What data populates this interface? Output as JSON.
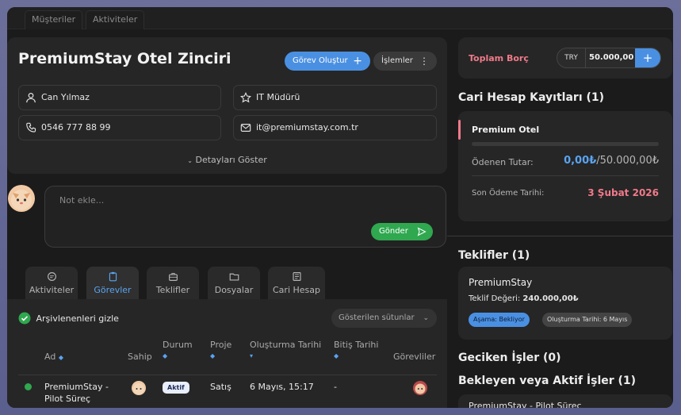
{
  "top_tabs": [
    "Müşteriler",
    "Aktiviteler"
  ],
  "company": {
    "name": "PremiumStay Otel Zinciri",
    "create_task_label": "Görev Oluştur",
    "actions_label": "İşlemler",
    "contact_name": "Can Yılmaz",
    "role": "IT Müdürü",
    "phone": "0546 777 88 99",
    "email": "it@premiumstay.com.tr",
    "show_details": "Detayları Göster"
  },
  "note": {
    "placeholder": "Not ekle...",
    "send_label": "Gönder"
  },
  "tabs": [
    {
      "label": "Aktiviteler",
      "icon": "chat-icon"
    },
    {
      "label": "Görevler",
      "icon": "clipboard-icon"
    },
    {
      "label": "Teklifler",
      "icon": "briefcase-icon"
    },
    {
      "label": "Dosyalar",
      "icon": "folder-icon"
    },
    {
      "label": "Cari Hesap",
      "icon": "ledger-icon"
    }
  ],
  "tasks": {
    "hide_archived": "Arşivlenenleri gizle",
    "columns_select": "Gösterilen sütunlar",
    "headers": {
      "name": "Ad",
      "owner": "Sahip",
      "status": "Durum",
      "project": "Proje",
      "created": "Oluşturma Tarihi",
      "due": "Bitiş Tarihi",
      "assignees": "Görevliler"
    },
    "rows": [
      {
        "name_line1": "PremiumStay -",
        "name_line2": "Pilot Süreç",
        "status": "Aktif",
        "project": "Satış",
        "created": "6 Mayıs, 15:17",
        "due": "-"
      }
    ]
  },
  "debt": {
    "label": "Toplam Borç",
    "currency": "TRY",
    "amount": "50.000,00"
  },
  "accounts": {
    "title": "Cari Hesap Kayıtları (1)",
    "item_name": "Premium Otel",
    "progress": 0,
    "paid_label": "Ödenen Tutar:",
    "paid_value": "0,00₺",
    "total_value": "/50.000,00₺",
    "due_label": "Son Ödeme Tarihi:",
    "due_value": "3 Şubat 2026"
  },
  "offers": {
    "title": "Teklifler (1)",
    "name": "PremiumStay",
    "value_label": "Teklif Değeri:",
    "value": "240.000,00₺",
    "stage": "Aşama: Bekliyor",
    "created": "Oluşturma Tarihi: 6 Mayıs"
  },
  "overdue_title": "Geciken İşler (0)",
  "pending_title": "Bekleyen veya Aktif İşler (1)",
  "pending_item": "PremiumStay - Pilot Süreç",
  "colors": {
    "accent": "#4a90e2",
    "success": "#2fa84f",
    "danger": "#f07a8a"
  }
}
